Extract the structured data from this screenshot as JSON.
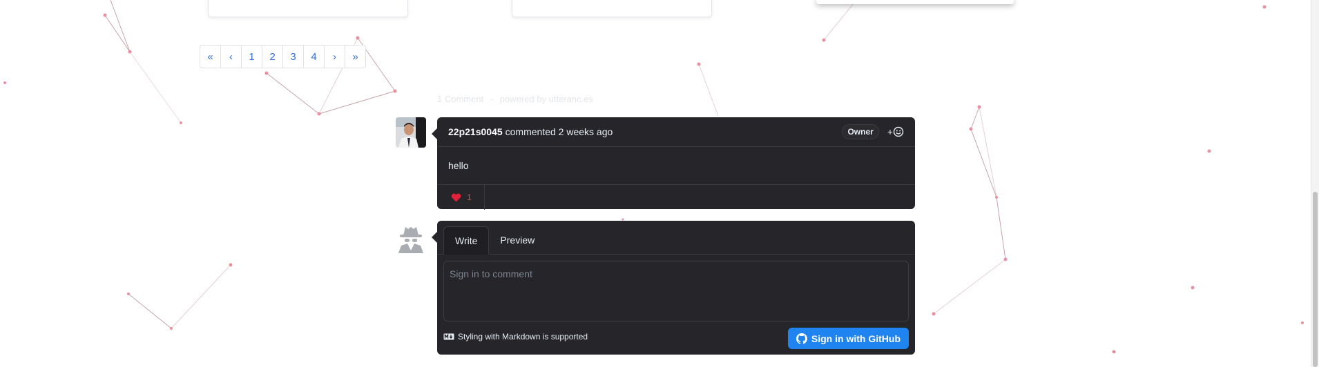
{
  "pagination": {
    "first": "«",
    "prev": "‹",
    "pages": [
      "1",
      "2",
      "3",
      "4"
    ],
    "next": "›",
    "last": "»"
  },
  "comments_meta": {
    "count_text": "1 Comment",
    "separator": "-",
    "powered_by": "powered by utteranc.es"
  },
  "comment": {
    "author": "22p21s0045",
    "action": "commented 2 weeks ago",
    "badge": "Owner",
    "add_reaction": "+",
    "body": "hello",
    "reaction_count": "1"
  },
  "editor": {
    "tab_write": "Write",
    "tab_preview": "Preview",
    "placeholder": "Sign in to comment",
    "markdown_note": "Styling with Markdown is supported",
    "signin_label": "Sign in with GitHub"
  },
  "colors": {
    "accent": "#1f83f0",
    "panel": "#25252a",
    "link": "#2f6fd7",
    "heart": "#e0213b"
  }
}
